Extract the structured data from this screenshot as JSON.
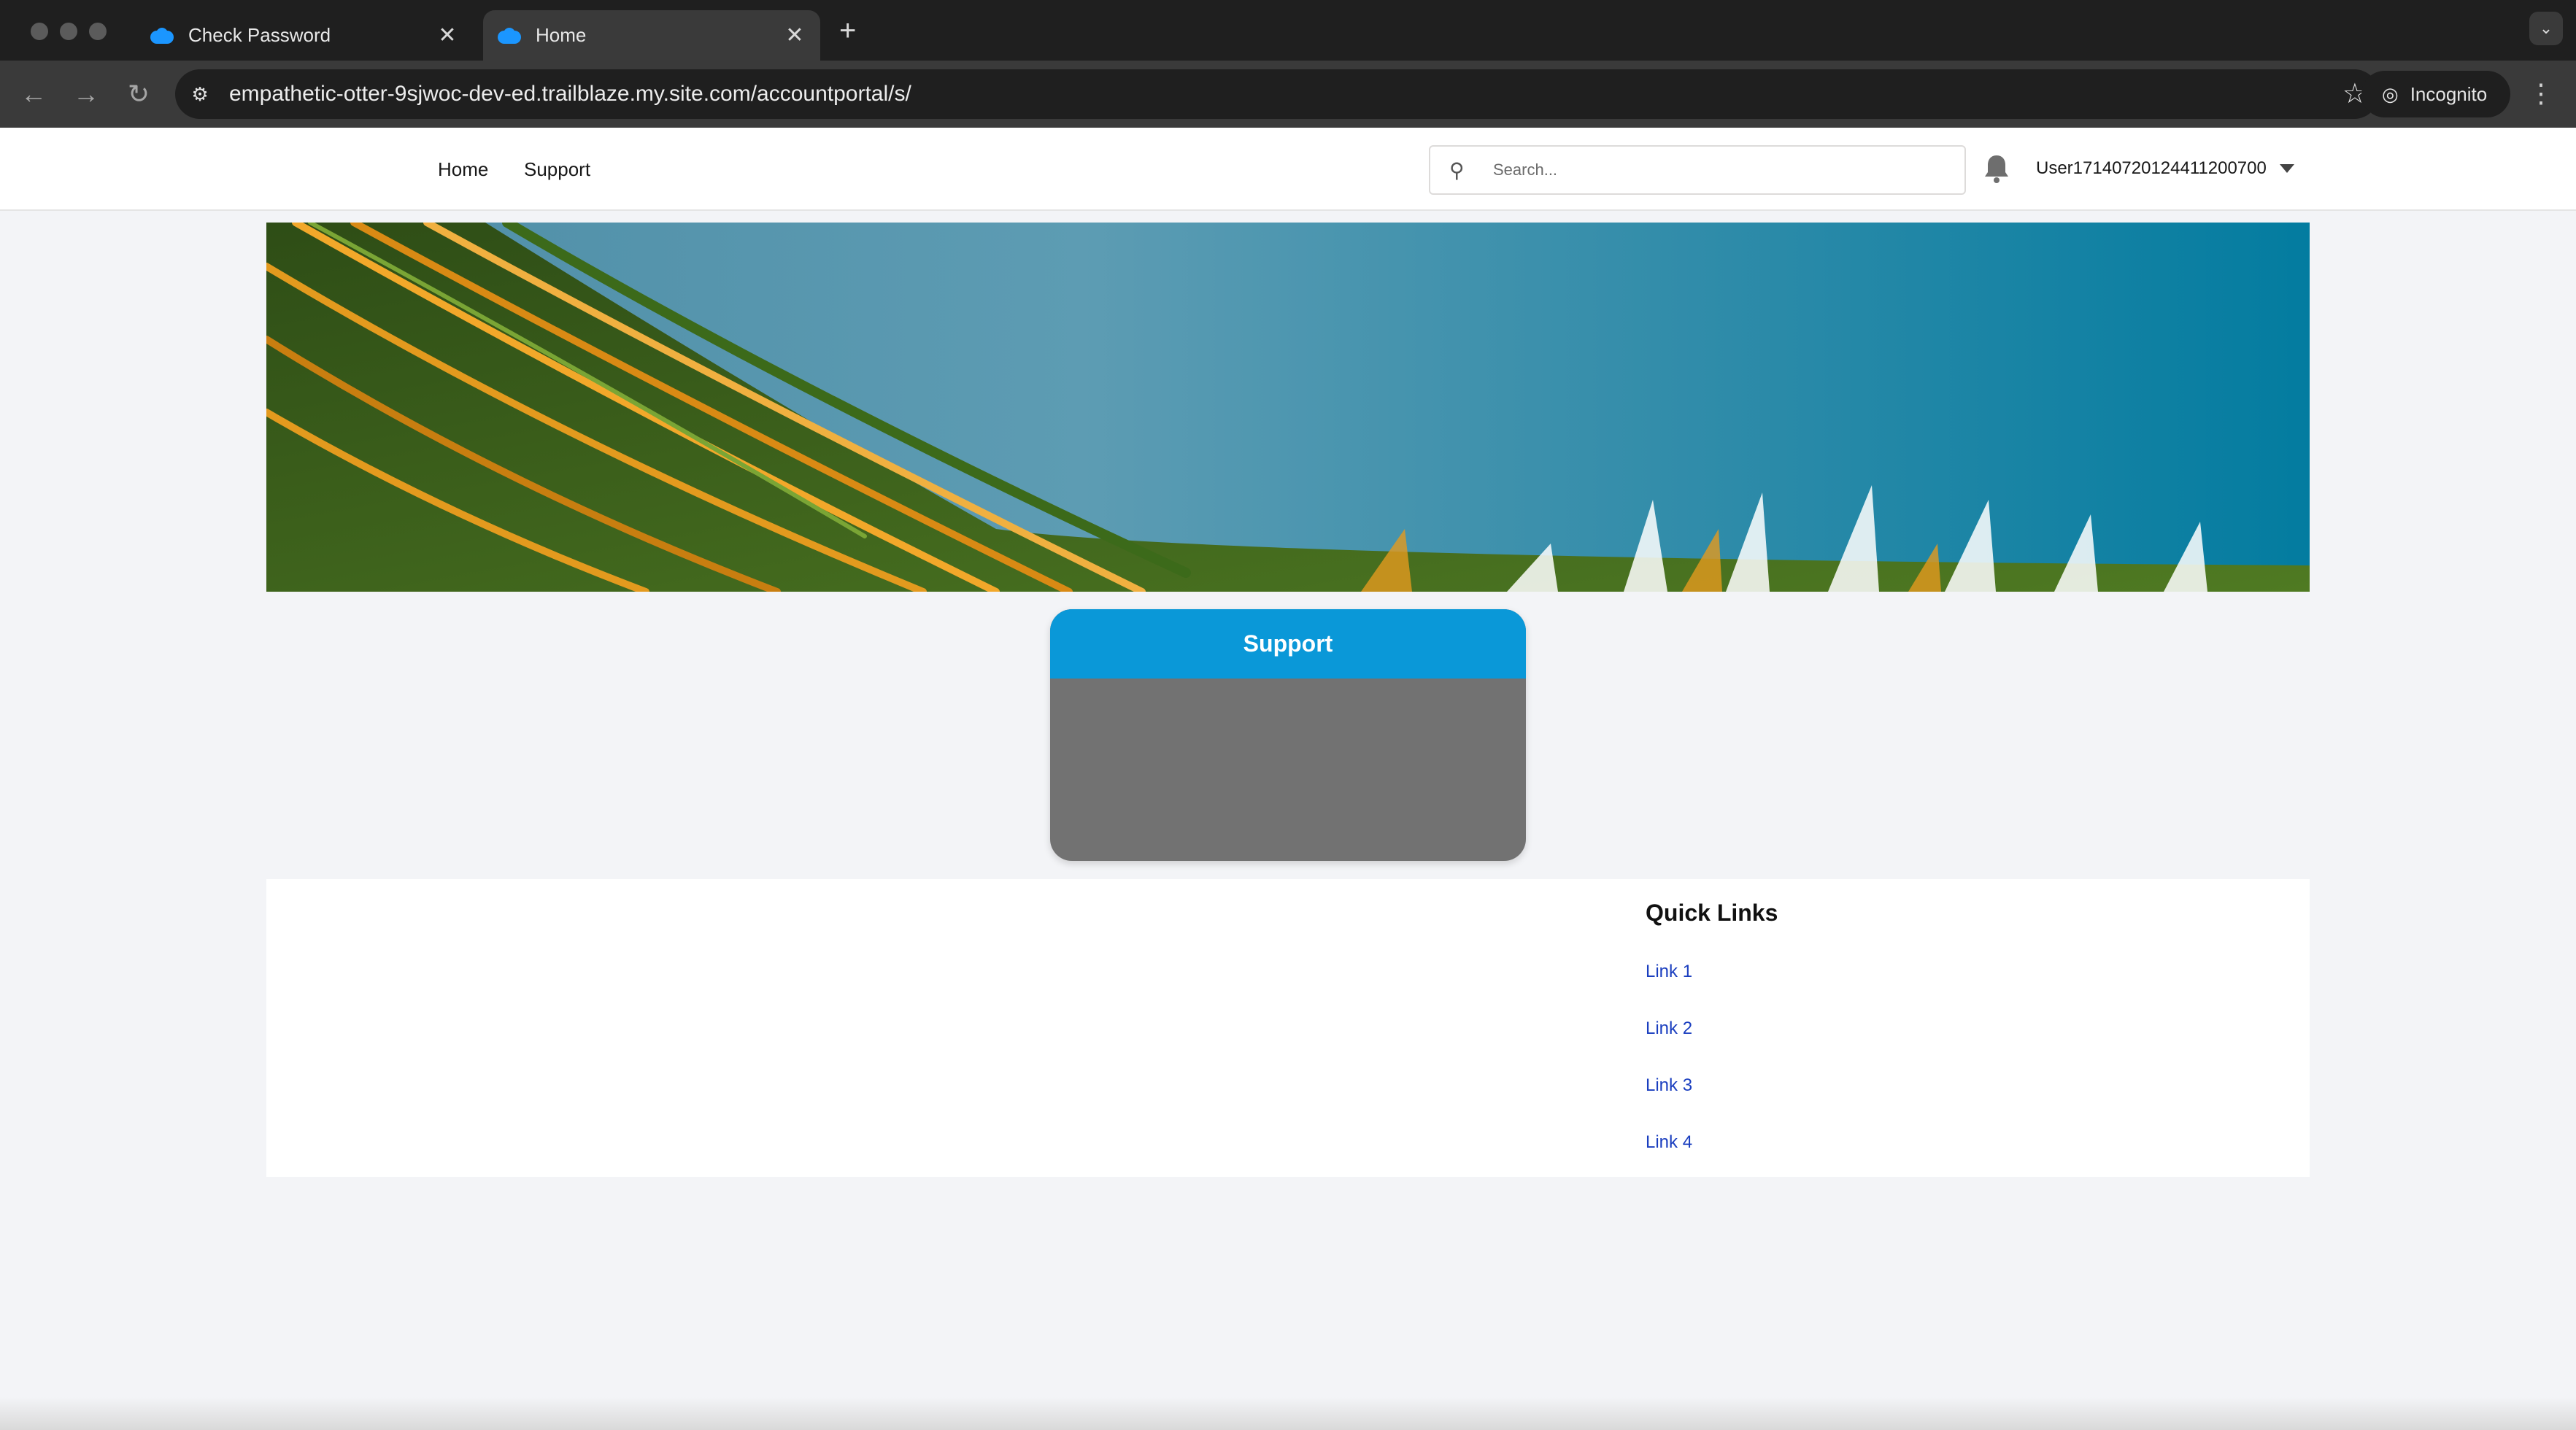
{
  "browser": {
    "tabs": [
      {
        "title": "Check Password",
        "active": false
      },
      {
        "title": "Home",
        "active": true
      }
    ],
    "url": "empathetic-otter-9sjwoc-dev-ed.trailblaze.my.site.com/accountportal/s/",
    "incognito_label": "Incognito"
  },
  "site": {
    "nav": [
      {
        "label": "Home"
      },
      {
        "label": "Support"
      }
    ],
    "search_placeholder": "Search...",
    "user_name": "User17140720124411200700"
  },
  "support_tile": {
    "title": "Support"
  },
  "quick_links": {
    "title": "Quick Links",
    "links": [
      {
        "label": "Link 1"
      },
      {
        "label": "Link 2"
      },
      {
        "label": "Link 3"
      },
      {
        "label": "Link 4"
      }
    ]
  },
  "colors": {
    "accent": "#0a98d8",
    "link": "#1a3ebf",
    "page_bg": "#f3f4f7"
  }
}
